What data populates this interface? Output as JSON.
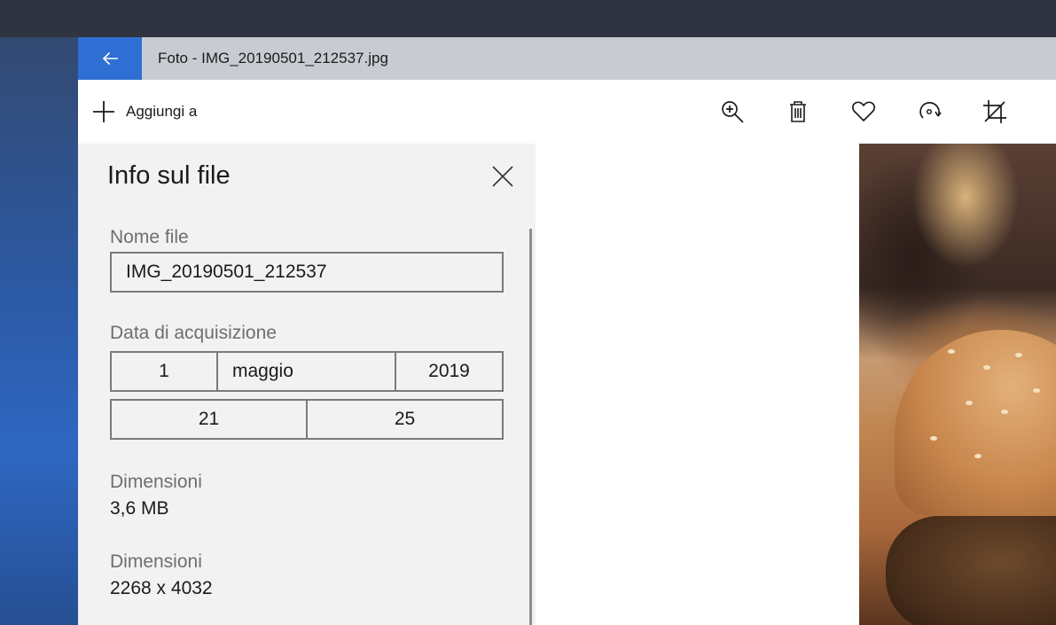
{
  "window": {
    "title": "Foto - IMG_20190501_212537.jpg"
  },
  "toolbar": {
    "add_label": "Aggiungi a",
    "icons": [
      "zoom-in-icon",
      "delete-icon",
      "favorite-icon",
      "rotate-icon",
      "crop-icon"
    ]
  },
  "panel": {
    "title": "Info sul file",
    "filename_label": "Nome file",
    "filename_value": "IMG_20190501_212537",
    "date_label": "Data di acquisizione",
    "date": {
      "day": "1",
      "month": "maggio",
      "year": "2019"
    },
    "time": {
      "hour": "21",
      "minute": "25"
    },
    "size_label": "Dimensioni",
    "size_value": "3,6 MB",
    "dimensions_label": "Dimensioni",
    "dimensions_value": "2268 x 4032"
  },
  "colors": {
    "accent": "#2f6fd3",
    "titlebar": "#c8ccd2",
    "panel_bg": "#f2f2f2"
  }
}
